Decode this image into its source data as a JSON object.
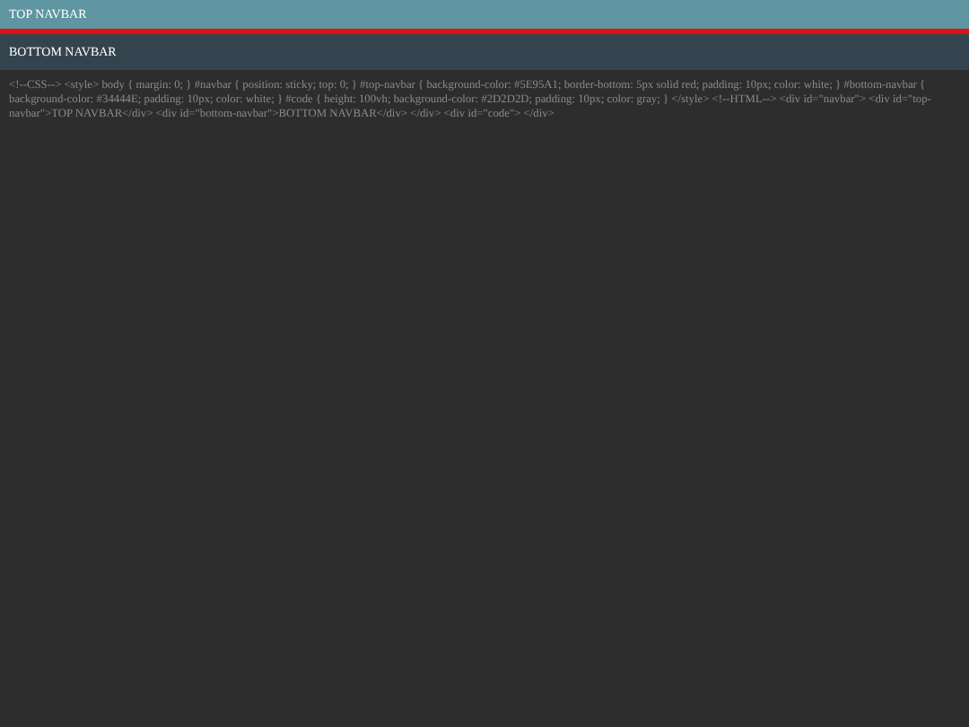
{
  "top_navbar": {
    "title": "TOP NAVBAR"
  },
  "bottom_navbar": {
    "title": "BOTTOM NAVBAR"
  },
  "code": {
    "text": "<!--CSS--> <style> body { margin: 0; } #navbar { position: sticky; top: 0; } #top-navbar { background-color: #5E95A1; border-bottom: 5px solid red; padding: 10px; color: white; } #bottom-navbar { background-color: #34444E; padding: 10px; color: white; } #code { height: 100vh; background-color: #2D2D2D; padding: 10px; color: gray; } </style> <!--HTML--> <div id=\"navbar\"> <div id=\"top-navbar\">TOP NAVBAR</div> <div id=\"bottom-navbar\">BOTTOM NAVBAR</div> </div> <div id=\"code\"> </div>"
  }
}
